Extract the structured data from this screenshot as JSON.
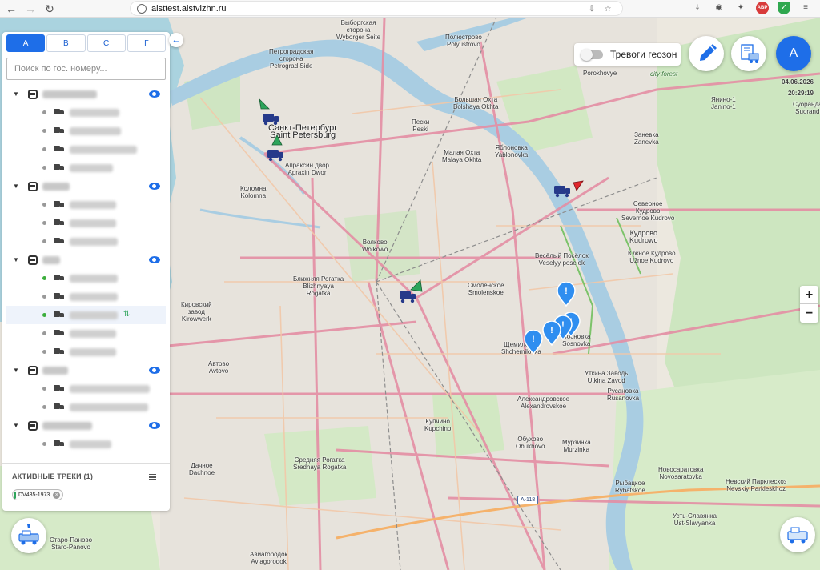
{
  "browser": {
    "url_host": "aisttest.aistvizhn.ru"
  },
  "sidebar": {
    "tabs": [
      {
        "label": "А"
      },
      {
        "label": "В"
      },
      {
        "label": "С"
      },
      {
        "label": "Г"
      }
    ],
    "search_placeholder": "Поиск по гос. номеру...",
    "active_tracks_title": "АКТИВНЫЕ ТРЕКИ (1)",
    "active_track_chip": "DV435-1973"
  },
  "map_controls": {
    "geozone_alarms_label": "Тревоги геозон",
    "user_initial": "А",
    "date": "04.06.2026",
    "time": "20:29:19",
    "zoom_in": "+",
    "zoom_out": "−"
  },
  "map_labels": {
    "spb": "Санкт-Петербург\nSaint Petersburg",
    "petrograd": "Петроградская\nсторона\nPetrograd Side",
    "vyborg": "Выборгская\nсторона\nWyborger Seite",
    "polyustrovo": "Полюстрово\nPolyustrovo",
    "bolshaya_okhta": "Большая Охта\nBolshaya Okhta",
    "peski": "Пески\nPeski",
    "malaya_okhta": "Малая Охта\nMalaya Okhta",
    "yablonovka": "Яблоновка\nYablonovka",
    "apraksin": "Апраксин двор\nApraxin Dwor",
    "kolomna": "Коломна\nKolomna",
    "volkovo": "Волково\nWolkowo",
    "blizhnyaya": "Ближняя Рогатка\nBlizhnyaya\nRogatka",
    "smolenskoe": "Смоленское\nSmolenskoe",
    "vesely": "Весёлый Посёлок\nVeselyy poselok",
    "kudrovo": "Кудрово\nKudrowo",
    "severnoe_kudrovo": "Северное\nКудрово\nSevernoe Kudrovo",
    "yuzhnoe_kudrovo": "Южное Кудрово\nUžnoe Kudrovo",
    "zanevka": "Заневка\nZanevka",
    "porokhovye": "Porokhovye",
    "city_forest": "city forest",
    "yanino": "Янино-1\nJanino-1",
    "suoranda": "Суоранда\nSuorand",
    "sosnovka": "Сосновка\nSosnovka",
    "shchemilovka": "Щемиловка\nShchemilovka",
    "utkina": "Уткина Заводь\nUtkina Zavod",
    "rusanovka": "Русановка\nRusanovka",
    "alexandrovskoe": "Александровское\nAlexandrovskoe",
    "kupchino": "Купчино\nKupchino",
    "obukhovo": "Обухово\nObukhovo",
    "murzinka": "Мурзинка\nMurzinka",
    "srednyaya": "Средняя Рогатка\nSrednaya Rogatka",
    "dachnoe": "Дачное\nDachnoe",
    "avtovo": "Автово\nAvtovo",
    "novosaratovka": "Новосаратовка\nNovosaratovka",
    "nevsky_park": "Невский Парклесхоз\nNevskiy Parkleskhoz",
    "rybatskoe": "Рыбацкое\nRybatskoe",
    "ust_slavyanka": "Усть-Славянка\nUst-Slavyanka",
    "staro_panovo": "Старо-Паново\nStaro-Panovo",
    "aviagorodok": "Авиагородок\nAviagorodok",
    "sosnovka2": "Сосновка\nSosnovka",
    "kirov": "Кировский\nзавод\nKirowwerk",
    "a118": "A-118"
  },
  "colors": {
    "accent": "#1e6ee8",
    "water": "#aad3df",
    "river": "#a9cde2",
    "park": "#cde6c0",
    "road_major": "#e48ea4"
  }
}
